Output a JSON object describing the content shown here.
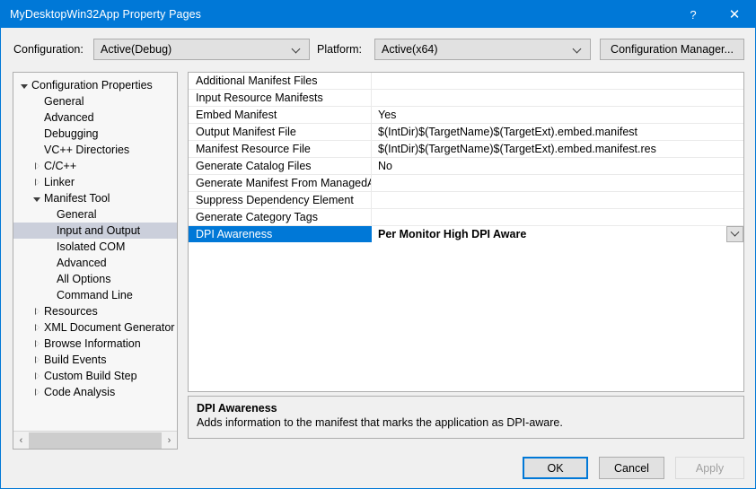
{
  "window": {
    "title": "MyDesktopWin32App Property Pages",
    "help_label": "?",
    "close_label": "✕",
    "accent_color": "#0078d7"
  },
  "toolbar": {
    "configuration_label": "Configuration:",
    "configuration_value": "Active(Debug)",
    "platform_label": "Platform:",
    "platform_value": "Active(x64)",
    "configuration_manager_label": "Configuration Manager..."
  },
  "tree": {
    "nodes": [
      {
        "label": "Configuration Properties",
        "indent": 0,
        "state": "expanded",
        "selected": false
      },
      {
        "label": "General",
        "indent": 1,
        "state": "leaf",
        "selected": false
      },
      {
        "label": "Advanced",
        "indent": 1,
        "state": "leaf",
        "selected": false
      },
      {
        "label": "Debugging",
        "indent": 1,
        "state": "leaf",
        "selected": false
      },
      {
        "label": "VC++ Directories",
        "indent": 1,
        "state": "leaf",
        "selected": false
      },
      {
        "label": "C/C++",
        "indent": 1,
        "state": "collapsed",
        "selected": false
      },
      {
        "label": "Linker",
        "indent": 1,
        "state": "collapsed",
        "selected": false
      },
      {
        "label": "Manifest Tool",
        "indent": 1,
        "state": "expanded",
        "selected": false
      },
      {
        "label": "General",
        "indent": 2,
        "state": "leaf",
        "selected": false
      },
      {
        "label": "Input and Output",
        "indent": 2,
        "state": "leaf",
        "selected": true
      },
      {
        "label": "Isolated COM",
        "indent": 2,
        "state": "leaf",
        "selected": false
      },
      {
        "label": "Advanced",
        "indent": 2,
        "state": "leaf",
        "selected": false
      },
      {
        "label": "All Options",
        "indent": 2,
        "state": "leaf",
        "selected": false
      },
      {
        "label": "Command Line",
        "indent": 2,
        "state": "leaf",
        "selected": false
      },
      {
        "label": "Resources",
        "indent": 1,
        "state": "collapsed",
        "selected": false
      },
      {
        "label": "XML Document Generator",
        "indent": 1,
        "state": "collapsed",
        "selected": false
      },
      {
        "label": "Browse Information",
        "indent": 1,
        "state": "collapsed",
        "selected": false
      },
      {
        "label": "Build Events",
        "indent": 1,
        "state": "collapsed",
        "selected": false
      },
      {
        "label": "Custom Build Step",
        "indent": 1,
        "state": "collapsed",
        "selected": false
      },
      {
        "label": "Code Analysis",
        "indent": 1,
        "state": "collapsed",
        "selected": false
      }
    ],
    "scroll_left_label": "‹",
    "scroll_right_label": "›"
  },
  "grid": {
    "rows": [
      {
        "name": "Additional Manifest Files",
        "value": "",
        "selected": false,
        "dropdown": false
      },
      {
        "name": "Input Resource Manifests",
        "value": "",
        "selected": false,
        "dropdown": false
      },
      {
        "name": "Embed Manifest",
        "value": "Yes",
        "selected": false,
        "dropdown": false
      },
      {
        "name": "Output Manifest File",
        "value": "$(IntDir)$(TargetName)$(TargetExt).embed.manifest",
        "selected": false,
        "dropdown": false
      },
      {
        "name": "Manifest Resource File",
        "value": "$(IntDir)$(TargetName)$(TargetExt).embed.manifest.res",
        "selected": false,
        "dropdown": false
      },
      {
        "name": "Generate Catalog Files",
        "value": "No",
        "selected": false,
        "dropdown": false
      },
      {
        "name": "Generate Manifest From ManagedAssembly",
        "value": "",
        "selected": false,
        "dropdown": false
      },
      {
        "name": "Suppress Dependency Element",
        "value": "",
        "selected": false,
        "dropdown": false
      },
      {
        "name": "Generate Category Tags",
        "value": "",
        "selected": false,
        "dropdown": false
      },
      {
        "name": "DPI Awareness",
        "value": "Per Monitor High DPI Aware",
        "selected": true,
        "dropdown": true
      }
    ]
  },
  "description": {
    "title": "DPI Awareness",
    "body": "Adds information to the manifest that marks the application as DPI-aware."
  },
  "buttons": {
    "ok_label": "OK",
    "cancel_label": "Cancel",
    "apply_label": "Apply"
  }
}
